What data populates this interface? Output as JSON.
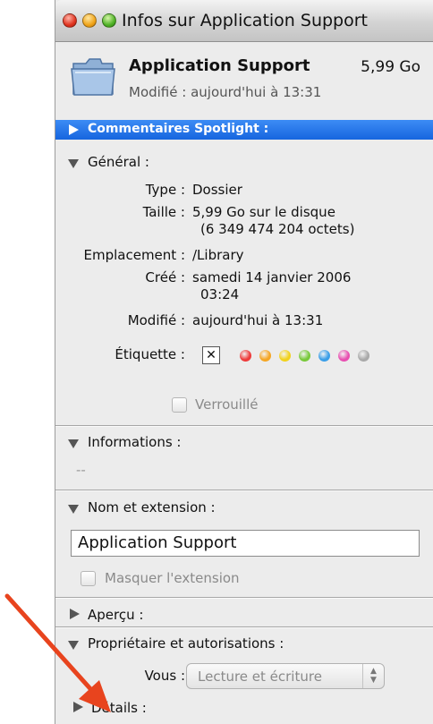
{
  "window": {
    "title": "Infos sur Application Support"
  },
  "header": {
    "name": "Application Support",
    "size": "5,99 Go",
    "modified": "Modifié : aujourd'hui à 13:31"
  },
  "spotlight": {
    "label": "Commentaires Spotlight :"
  },
  "general": {
    "label": "Général :",
    "type_label": "Type :",
    "type_value": "Dossier",
    "size_label": "Taille :",
    "size_value_1": "5,99 Go sur le disque",
    "size_value_2": "(6 349 474 204 octets)",
    "location_label": "Emplacement :",
    "location_value": "/Library",
    "created_label": "Créé :",
    "created_value_1": "samedi 14 janvier 2006",
    "created_value_2": "03:24",
    "modified_label": "Modifié :",
    "modified_value": "aujourd'hui à 13:31",
    "tag_label": "Étiquette :",
    "tag_none": "✕",
    "tag_colors": [
      "#ee3b3b",
      "#f5a623",
      "#f2d21b",
      "#78c93a",
      "#3a9ee8",
      "#e84fb1",
      "#a9a9a9"
    ],
    "locked_label": "Verrouillé"
  },
  "informations": {
    "label": "Informations :",
    "value": "--"
  },
  "name_ext": {
    "label": "Nom et extension :",
    "field_value": "Application Support",
    "hide_ext_label": "Masquer l'extension"
  },
  "preview": {
    "label": "Aperçu :"
  },
  "ownership": {
    "label": "Propriétaire et autorisations :",
    "you_label": "Vous :",
    "you_value": "Lecture et écriture",
    "details_label": "Détails :"
  },
  "colors": {
    "selection_bar": "#1f6fe6",
    "annotation_arrow": "#e8441e"
  }
}
